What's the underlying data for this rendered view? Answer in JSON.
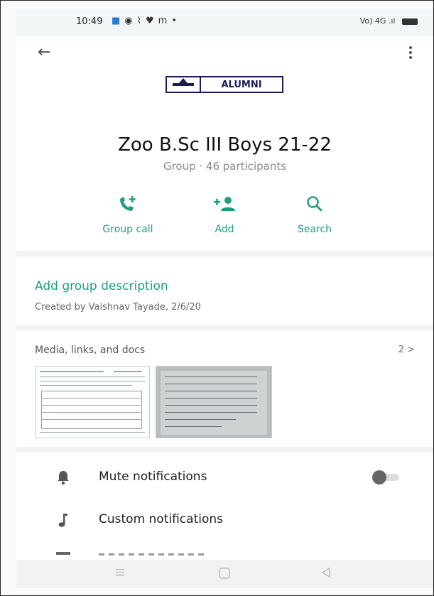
{
  "status_bar": {
    "time": "10:49",
    "icons": [
      "app-icon",
      "signal-icon",
      "wifi-icon",
      "twitter-icon",
      "mail-icon",
      "dot-icon"
    ],
    "right_text": "Vo) 4G .ıl"
  },
  "header": {
    "logo_text": "ALUMNI"
  },
  "group": {
    "name": "Zoo B.Sc III Boys 21-22",
    "subtitle": "Group · 46 participants"
  },
  "actions": [
    {
      "label": "Group call",
      "icon": "group-call-icon"
    },
    {
      "label": "Add",
      "icon": "add-person-icon"
    },
    {
      "label": "Search",
      "icon": "search-icon"
    }
  ],
  "description": {
    "link": "Add group description",
    "created": "Created by Vaishnav Tayade, 2/6/20"
  },
  "media": {
    "title": "Media, links, and docs",
    "count": "2 >"
  },
  "settings": [
    {
      "label": "Mute notifications",
      "icon": "bell-icon"
    },
    {
      "label": "Custom notifications",
      "icon": "music-note-icon"
    }
  ],
  "toggle": {
    "mute_state": "off"
  },
  "colors": {
    "accent": "#1f9e7f",
    "logo": "#1a1d5a"
  }
}
